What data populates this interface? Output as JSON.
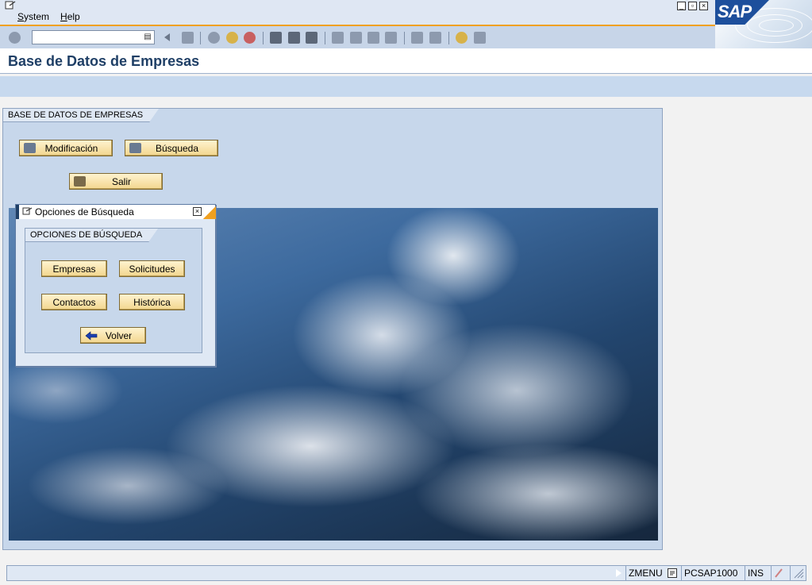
{
  "window": {
    "menu": [
      "System",
      "Help"
    ],
    "controls": [
      "minimize-icon",
      "restore-icon",
      "close-icon"
    ],
    "logo_text": "SAP"
  },
  "toolbar": {
    "command_field_value": "",
    "icons": [
      "enter-icon",
      "back-icon",
      "save-icon",
      "back-nav-icon",
      "exit-icon",
      "cancel-icon",
      "print-icon",
      "find-icon",
      "find-next-icon",
      "first-page-icon",
      "prev-page-icon",
      "next-page-icon",
      "last-page-icon",
      "new-session-icon",
      "shortcut-icon",
      "help-icon",
      "layout-icon"
    ]
  },
  "screen": {
    "title": "Base de Datos de Empresas"
  },
  "main_group": {
    "title": "BASE DE DATOS DE EMPRESAS",
    "buttons": {
      "modificacion": "Modificación",
      "busqueda": "Búsqueda",
      "salir": "Salir"
    }
  },
  "dialog": {
    "title": "Opciones de Búsqueda",
    "group_title": "OPCIONES DE BÚSQUEDA",
    "buttons": {
      "empresas": "Empresas",
      "solicitudes": "Solicitudes",
      "contactos": "Contactos",
      "historica": "Histórica",
      "volver": "Volver"
    }
  },
  "status": {
    "transaction": "ZMENU",
    "server": "PCSAP1000",
    "mode": "INS"
  },
  "colors": {
    "accent": "#f0a020",
    "title_text": "#1f3f66",
    "button_fill": "#f2d68e"
  }
}
